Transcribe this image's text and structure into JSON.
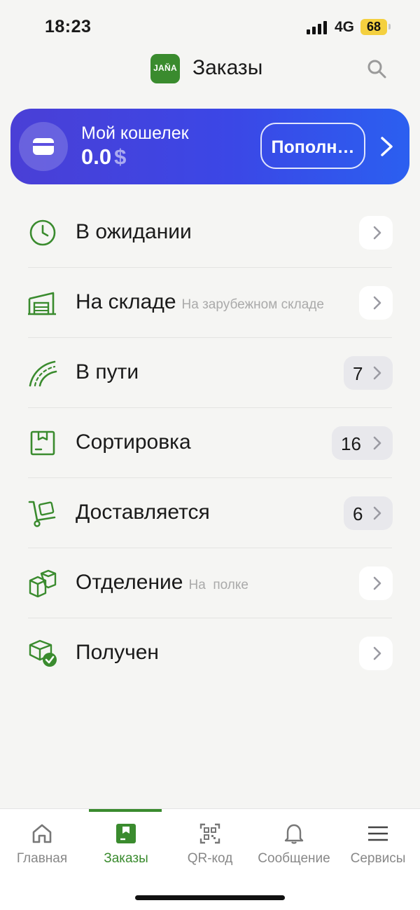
{
  "status": {
    "time": "18:23",
    "network": "4G",
    "battery": "68"
  },
  "header": {
    "logo_text": "JAŇA",
    "title": "Заказы",
    "search_icon": "search-icon"
  },
  "wallet": {
    "label": "Мой кошелек",
    "amount": "0.0",
    "currency": "$",
    "topup_label": "Пополн…"
  },
  "orders": [
    {
      "icon": "clock-icon",
      "label": "В ожидании",
      "hint": "",
      "count": ""
    },
    {
      "icon": "warehouse-icon",
      "label": "На складе",
      "hint": "На зарубежном складе",
      "count": ""
    },
    {
      "icon": "road-icon",
      "label": "В пути",
      "hint": "",
      "count": "7"
    },
    {
      "icon": "box-icon",
      "label": "Сортировка",
      "hint": "",
      "count": "16"
    },
    {
      "icon": "hand-truck-icon",
      "label": "Доставляется",
      "hint": "",
      "count": "6"
    },
    {
      "icon": "packages-icon",
      "label": "Отделение",
      "hint": "На  полке",
      "count": ""
    },
    {
      "icon": "package-check-icon",
      "label": "Получен",
      "hint": "",
      "count": ""
    }
  ],
  "nav": [
    {
      "icon": "home-icon",
      "label": "Главная",
      "active": false
    },
    {
      "icon": "orders-icon",
      "label": "Заказы",
      "active": true
    },
    {
      "icon": "qr-code-icon",
      "label": "QR-код",
      "active": false
    },
    {
      "icon": "bell-icon",
      "label": "Сообщение",
      "active": false
    },
    {
      "icon": "menu-icon",
      "label": "Сервисы",
      "active": false
    }
  ],
  "colors": {
    "accent": "#3a8b2e",
    "wallet_start": "#4a3fd6",
    "wallet_end": "#2b5ff0",
    "background": "#f5f5f3"
  }
}
